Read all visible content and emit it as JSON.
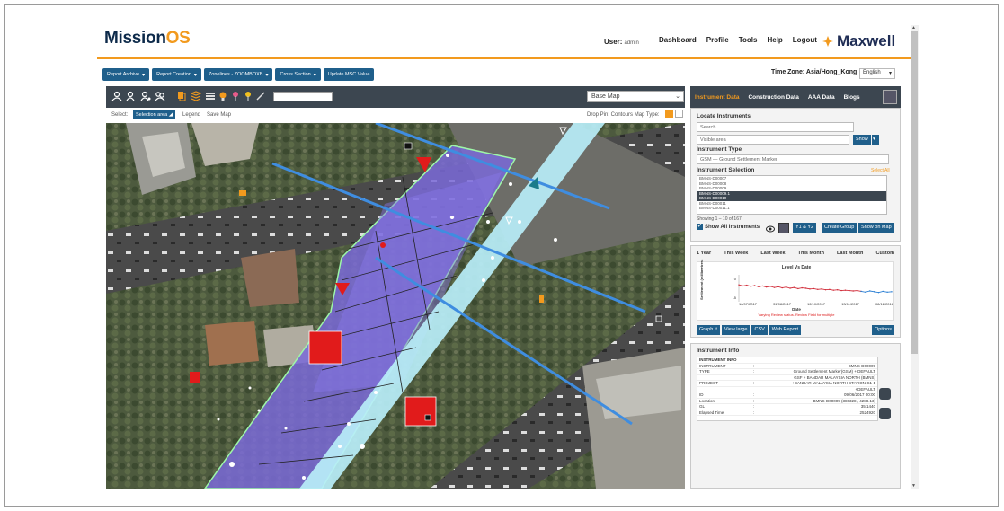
{
  "header": {
    "logo_main": "Mission",
    "logo_accent": "OS",
    "user_label": "User:",
    "user_name": "admin",
    "nav": [
      "Dashboard",
      "Profile",
      "Tools",
      "Help",
      "Logout"
    ],
    "brand": "Maxwell"
  },
  "toolbar": {
    "buttons": [
      "Report Archive",
      "Report Creation",
      "Zonelines - ZOOMBOXB",
      "Cross Section",
      "Update MSC Value"
    ],
    "timezone": "Time Zone: Asia/Hong_Kong",
    "language": "English"
  },
  "map_toolbar": {
    "basemap": "Base Map",
    "select_label": "Select:",
    "selection_area": "Selection area",
    "legend": "Legend",
    "save_map": "Save Map",
    "right_options": "Drop Pin: Contours Map Type:"
  },
  "right_tabs": [
    "Instrument Data",
    "Construction Data",
    "AAA Data",
    "Blogs"
  ],
  "locate": {
    "title": "Locate Instruments",
    "search_placeholder": "Search",
    "area_value": "Visible area",
    "show_label": "Show",
    "type_title": "Instrument Type",
    "type_value": "GSM — Ground Settlement Marker",
    "selection_title": "Instrument Selection",
    "select_all": "Select All",
    "items": [
      "BMNS-D00007",
      "BMNS-D00008",
      "BMNS-D00009",
      "BMNS-D00009.1",
      "BMNS-D00010",
      "BMNS-D00011",
      "BMNS-D00011.1"
    ],
    "selected_index": [
      3,
      4
    ],
    "showing": "Showing 1 – 10 of 167",
    "show_all": "Show All Instruments",
    "buttons": [
      "Y1 & Y2",
      "Create Group",
      "Show on Map"
    ]
  },
  "chart_panel": {
    "ranges": [
      "1 Year",
      "This Week",
      "Last Week",
      "This Month",
      "Last Month",
      "Custom"
    ],
    "buttons": [
      "Graph It",
      "View large",
      "CSV",
      "Web Report"
    ],
    "options": "Options"
  },
  "chart_data": {
    "type": "line",
    "title": "Level Vs Date",
    "xlabel": "Date",
    "ylabel": "Settlement (millimetres)",
    "x_ticks": [
      "16/07/2017",
      "31/08/2017",
      "12/10/2017",
      "13/11/2017",
      "08/12/2018"
    ],
    "y_ticks": [
      "0",
      "-5"
    ],
    "warning": "Varying Review status. Review Field for multiple",
    "series": [
      {
        "color": "#d12d3a",
        "values": [
          -1.6,
          -1.9,
          -1.7,
          -2.0,
          -1.8,
          -2.1,
          -1.9,
          -2.2,
          -2.0,
          -2.3,
          -2.1,
          -2.4,
          -2.2,
          -2.5,
          -2.3,
          -2.6,
          -2.4,
          -2.5,
          -2.7,
          -2.6,
          -2.8,
          -2.7,
          -2.9,
          -2.8,
          -3.0,
          -2.9,
          -3.1,
          -3.0,
          -3.1,
          -3.2,
          -3.1,
          -3.3
        ]
      },
      {
        "color": "#2a7fd4",
        "values": [
          -3.3,
          -3.5,
          -3.2,
          -3.4,
          -3.6,
          -3.3,
          -3.5,
          -3.4
        ]
      }
    ]
  },
  "info": {
    "title": "Instrument Info",
    "rows": [
      {
        "k": "INSTRUMENT INFO",
        "v": ""
      },
      {
        "k": "INSTRUMENT",
        "v": "BMNS-D00009"
      },
      {
        "k": "TYPE",
        "v": "Ground Settlement Marker(GSM) + DEFAULT"
      },
      {
        "k": "",
        "v": "GSF + BANDAR MALAYSIA NORTH (BMNS)"
      },
      {
        "k": "PROJECT",
        "v": "+BANDAR MALAYSIA NORTH STATION-S1-1"
      },
      {
        "k": "",
        "v": "+DEFAULT"
      },
      {
        "k": "ID",
        "v": "09/06/2017 00:00"
      },
      {
        "k": "Location",
        "v": "BMNS-D00009 (380328 , 4288.13)"
      },
      {
        "k": "GL",
        "v": "35.1440"
      },
      {
        "k": "Elapsed Time",
        "v": "2524920"
      }
    ]
  }
}
